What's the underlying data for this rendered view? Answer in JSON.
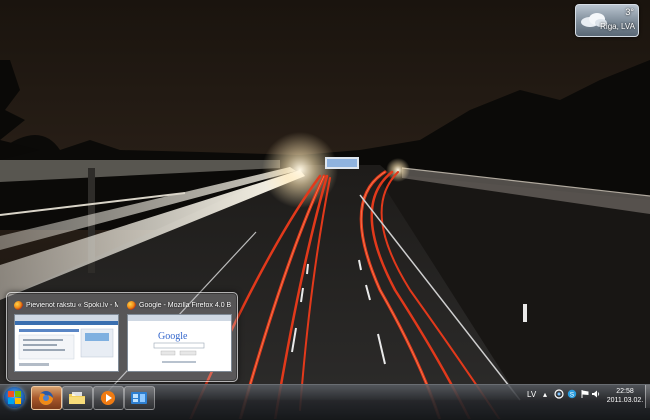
{
  "gadget": {
    "temperature": "3°",
    "location": "Riga, LVA"
  },
  "thumbnails": [
    {
      "title": "Pievienot rakstu « Spoki.lv - Mo...",
      "icon": "firefox-icon"
    },
    {
      "title": "Google - Mozilla Firefox 4.0 Beta...",
      "icon": "firefox-icon",
      "page_text": "Google"
    }
  ],
  "taskbar": {
    "pinned": [
      {
        "name": "firefox",
        "icon": "firefox-icon",
        "active": true
      },
      {
        "name": "explorer",
        "icon": "folder-icon",
        "active": false
      },
      {
        "name": "media-player",
        "icon": "media-player-icon",
        "active": false
      },
      {
        "name": "gadgets",
        "icon": "desktop-gadgets-icon",
        "active": false
      }
    ],
    "language": "LV",
    "clock_time": "22:58",
    "clock_date": "2011.03.02."
  },
  "colors": {
    "taillight": "#e0361a",
    "headlight": "#f4efe0",
    "sky": "#2a2018"
  }
}
